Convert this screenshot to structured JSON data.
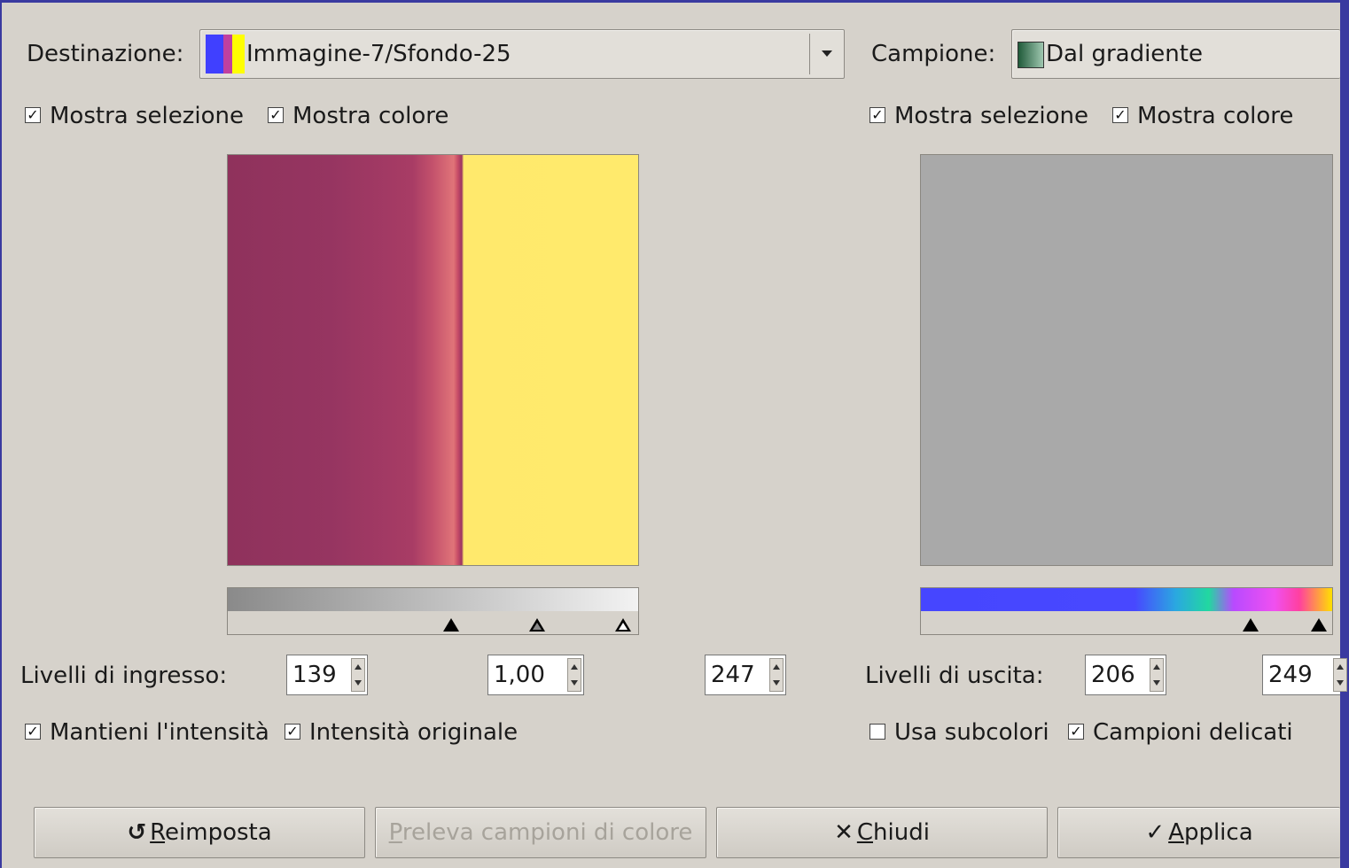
{
  "destination": {
    "label": "Destinazione:",
    "value": "Immagine-7/Sfondo-25",
    "icon": "layer-thumbnail-icon"
  },
  "sample": {
    "label": "Campione:",
    "value": "Dal gradiente",
    "icon": "gradient-swatch-icon"
  },
  "left_options": {
    "show_selection": "Mostra selezione",
    "show_color": "Mostra colore"
  },
  "right_options": {
    "show_selection": "Mostra selezione",
    "show_color": "Mostra colore"
  },
  "input_levels": {
    "label": "Livelli di ingresso:",
    "low": "139",
    "gamma": "1,00",
    "high": "247"
  },
  "output_levels": {
    "label": "Livelli di uscita:",
    "low": "206",
    "high": "249"
  },
  "bottom_left_options": {
    "keep_intensity": "Mantieni l'intensità",
    "original_intensity": "Intensità originale"
  },
  "bottom_right_options": {
    "use_subcolors": "Usa subcolori",
    "smooth_samples": "Campioni delicati"
  },
  "buttons": {
    "reset_prefix": "R",
    "reset_rest": "eimposta",
    "sample_prefix": "P",
    "sample_rest": "releva campioni di colore",
    "close_prefix": "C",
    "close_rest": "hiudi",
    "apply_prefix": "A",
    "apply_rest": "pplica"
  },
  "colors": {
    "background": "#d6d2cb",
    "window_border": "#3a3aa0",
    "preview_dark": "#953560",
    "preview_yellow": "#ffe96c",
    "sample_gray": "#a9a9a9"
  }
}
